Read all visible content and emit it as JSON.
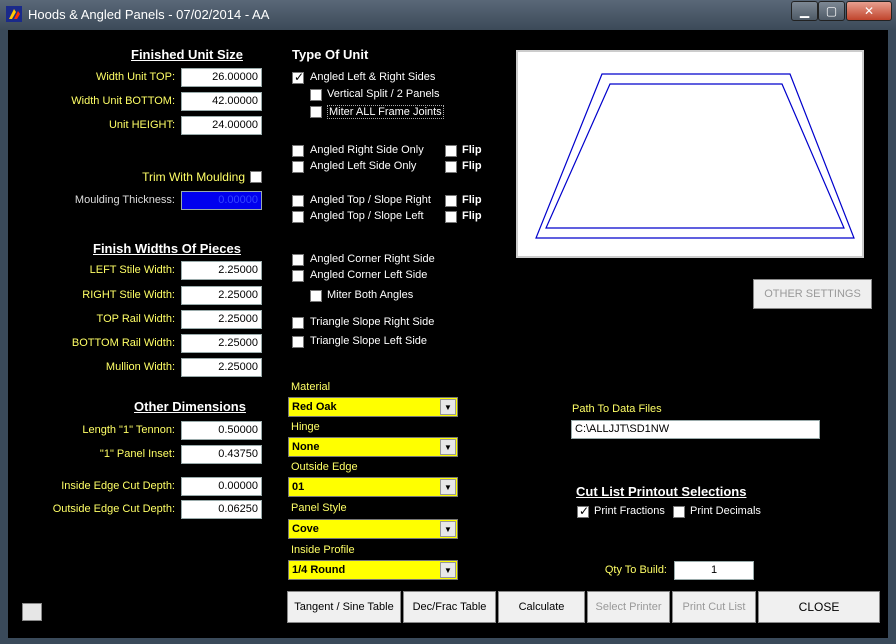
{
  "window": {
    "title": "Hoods & Angled Panels - 07/02/2014 - AA",
    "buttons": {
      "minimize": "▁",
      "maximize": "▢",
      "close": "✕"
    }
  },
  "finished_unit_size": {
    "header": "Finished Unit Size",
    "width_top_label": "Width Unit TOP:",
    "width_top": "26.00000",
    "width_bottom_label": "Width Unit BOTTOM:",
    "width_bottom": "42.00000",
    "height_label": "Unit HEIGHT:",
    "height": "24.00000"
  },
  "moulding": {
    "trim_label": "Trim With Moulding",
    "thickness_label": "Moulding Thickness:",
    "thickness": "0.00000"
  },
  "finish_widths": {
    "header": "Finish Widths Of Pieces",
    "left_stile_label": "LEFT Stile Width:",
    "left_stile": "2.25000",
    "right_stile_label": "RIGHT Stile Width:",
    "right_stile": "2.25000",
    "top_rail_label": "TOP Rail Width:",
    "top_rail": "2.25000",
    "bottom_rail_label": "BOTTOM Rail Width:",
    "bottom_rail": "2.25000",
    "mullion_label": "Mullion Width:",
    "mullion": "2.25000"
  },
  "other_dimensions": {
    "header": "Other Dimensions",
    "tennon_label": "Length \"1\" Tennon:",
    "tennon": "0.50000",
    "panel_inset_label": "\"1\" Panel Inset:",
    "panel_inset": "0.43750",
    "inside_cut_label": "Inside Edge Cut Depth:",
    "inside_cut": "0.00000",
    "outside_cut_label": "Outside Edge Cut Depth:",
    "outside_cut": "0.06250"
  },
  "type_of_unit": {
    "header": "Type Of Unit",
    "angled_lr": "Angled Left & Right Sides",
    "vertical_split": "Vertical Split / 2 Panels",
    "miter_all": "Miter ALL Frame Joints",
    "angled_right_only": "Angled Right Side Only",
    "angled_left_only": "Angled Left Side Only",
    "angled_top_right": "Angled Top / Slope Right",
    "angled_top_left": "Angled Top / Slope Left",
    "corner_right": "Angled Corner Right Side",
    "corner_left": "Angled Corner Left Side",
    "miter_both": "Miter Both Angles",
    "tri_right": "Triangle Slope Right Side",
    "tri_left": "Triangle Slope Left Side",
    "flip": "Flip"
  },
  "combos": {
    "material_label": "Material",
    "material": "Red Oak",
    "hinge_label": "Hinge",
    "hinge": "None",
    "outside_edge_label": "Outside Edge",
    "outside_edge": "01",
    "panel_style_label": "Panel Style",
    "panel_style": "Cove",
    "inside_profile_label": "Inside Profile",
    "inside_profile": "1/4 Round"
  },
  "right_panel": {
    "other_settings": "OTHER SETTINGS",
    "path_label": "Path To Data Files",
    "path": "C:\\ALLJJT\\SD1NW",
    "cutlist_header": "Cut List Printout Selections",
    "print_fractions": "Print Fractions",
    "print_decimals": "Print Decimals",
    "qty_label": "Qty To Build:",
    "qty": "1"
  },
  "bottom_buttons": {
    "tangent": "Tangent / Sine Table",
    "decfrac": "Dec/Frac Table",
    "calculate": "Calculate",
    "select_printer": "Select Printer",
    "print_cut_list": "Print Cut List",
    "close": "CLOSE"
  },
  "colors": {
    "label_yellow": "#ffff66",
    "combo_yellow": "#ffff00",
    "moulding_blue": "#0000ee",
    "preview_line": "#0000cc"
  }
}
